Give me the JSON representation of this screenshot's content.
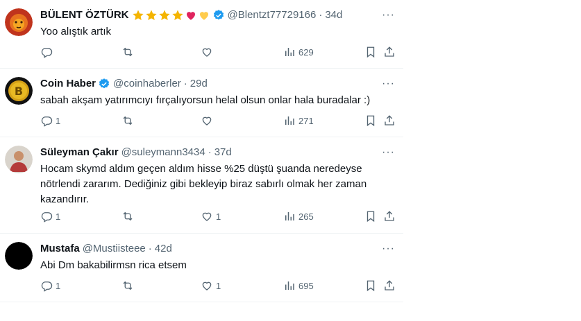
{
  "tweets": [
    {
      "name": "BÜLENT ÖZTÜRK",
      "emoji": [
        "star",
        "star",
        "star",
        "star",
        "red-heart",
        "yellow-heart"
      ],
      "verified": true,
      "handle": "@Blentzt77729166",
      "sep": "·",
      "time": "34d",
      "text": "Yoo alıştık artık",
      "replies": "",
      "reposts": "",
      "likes": "",
      "views": "629",
      "more": "···"
    },
    {
      "name": "Coin Haber",
      "verified": true,
      "handle": "@coinhaberler",
      "sep": "·",
      "time": "29d",
      "text": "sabah akşam yatırımcıyı fırçalıyorsun helal olsun onlar hala buradalar :)",
      "replies": "1",
      "reposts": "",
      "likes": "",
      "views": "271",
      "more": "···"
    },
    {
      "name": "Süleyman Çakır",
      "verified": false,
      "handle": "@suleymann3434",
      "sep": "·",
      "time": "37d",
      "text": "Hocam skymd aldım geçen aldım hisse %25 düştü şuanda neredeyse\nnötrlendi zararım. Dediğiniz gibi bekleyip biraz sabırlı olmak her zaman\nkazandırır.",
      "replies": "1",
      "reposts": "",
      "likes": "1",
      "views": "265",
      "more": "···"
    },
    {
      "name": "Mustafa",
      "verified": false,
      "handle": "@Mustiisteee",
      "sep": "·",
      "time": "42d",
      "text": "Abi Dm bakabilirmsn rica etsem",
      "replies": "1",
      "reposts": "",
      "likes": "1",
      "views": "695",
      "more": "···"
    }
  ],
  "colors": {
    "text": "#0f1419",
    "muted": "#536471",
    "verified": "#1d9bf0",
    "divider": "#eff3f4"
  }
}
